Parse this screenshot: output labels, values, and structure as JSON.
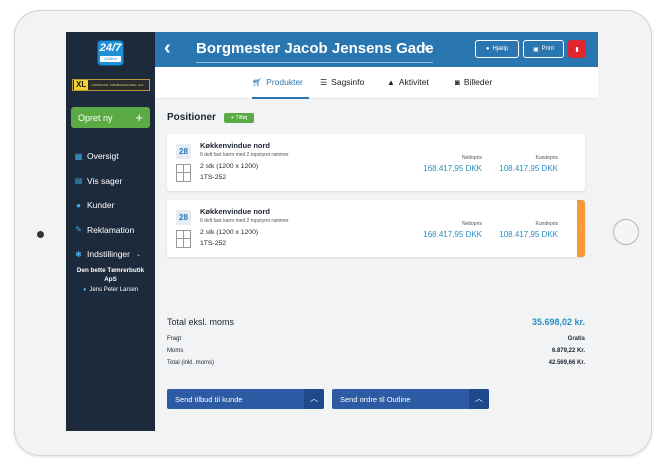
{
  "app": {
    "logo_text": "24/7",
    "logo_sub": "Outline",
    "partner_mark": "XL",
    "partner_text": "HJØRRING TØMMERHANDEL A/S"
  },
  "sidebar": {
    "create_label": "Opret ny",
    "create_icon": "+",
    "items": [
      {
        "label": "Oversigt",
        "icon": "dashboard-icon"
      },
      {
        "label": "Vis sager",
        "icon": "document-icon"
      },
      {
        "label": "Kunder",
        "icon": "person-icon"
      },
      {
        "label": "Reklamation",
        "icon": "wrench-icon"
      },
      {
        "label": "Indstillinger",
        "icon": "gear-icon"
      }
    ],
    "company": "Den bette Tømrerbutik ApS",
    "user": "Jens Peter Larsen"
  },
  "header": {
    "title": "Borgmester Jacob Jensens Gade",
    "help_label": "Hjælp",
    "print_label": "Print"
  },
  "tabs": [
    {
      "label": "Produkter",
      "icon": "cart-icon",
      "active": true
    },
    {
      "label": "Sagsinfo",
      "icon": "list-icon",
      "active": false
    },
    {
      "label": "Aktivitet",
      "icon": "bell-icon",
      "active": false
    },
    {
      "label": "Billeder",
      "icon": "camera-icon",
      "active": false
    }
  ],
  "positions": {
    "title": "Positioner",
    "add_label": "+ Tilføj",
    "items": [
      {
        "number": "28",
        "name": "Køkkenvindue nord",
        "description": "6 delt fast karm med 2 topstyret rammer",
        "dimension": "2 stk (1200 x 1200)",
        "code": "1TS-252",
        "net_label": "Nettopris",
        "net_price": "168.417,95 DKK",
        "customer_label": "Kundepris",
        "customer_price": "108.417,95 DKK"
      },
      {
        "number": "28",
        "name": "Køkkenvindue nord",
        "description": "6 delt fast karm med 2 topstyret rammer",
        "dimension": "2 stk (1200 x 1200)",
        "code": "1TS-252",
        "net_label": "Nettopris",
        "net_price": "168.417,95 DKK",
        "customer_label": "Kundepris",
        "customer_price": "108.417,95 DKK"
      }
    ]
  },
  "totals": {
    "total_label": "Total eksl. moms",
    "total_value": "35.698,02 kr.",
    "freight_label": "Fragt",
    "freight_value": "Gratis",
    "vat_label": "Moms",
    "vat_value": "6.879,22 Kr.",
    "incl_label": "Total (inkl. moms)",
    "incl_value": "42.569,66 Kr."
  },
  "actions": {
    "send_quote": "Send tilbud til kunde",
    "send_order": "Send ordre til Outline"
  },
  "colors": {
    "header": "#2a76b0",
    "sidebar": "#1d2a3c",
    "green": "#5aab44",
    "price": "#2a8fc4",
    "action": "#2c5ba3",
    "flag": "#f29b38",
    "delete": "#e2262f"
  }
}
